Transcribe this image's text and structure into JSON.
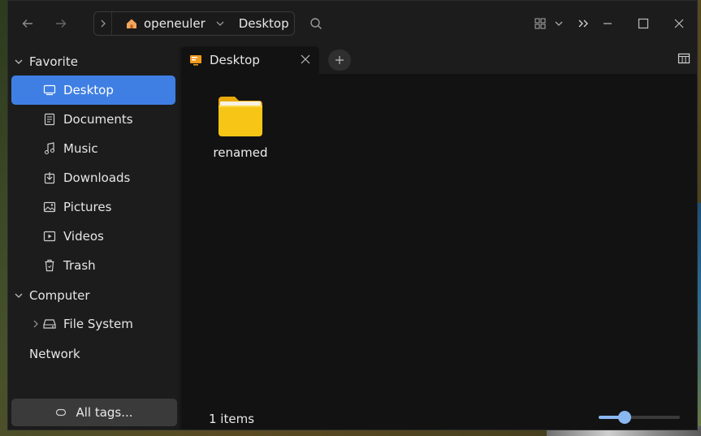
{
  "window": {
    "breadcrumb": {
      "home": "openeuler",
      "current": "Desktop"
    }
  },
  "sidebar": {
    "groups": {
      "favorite": "Favorite",
      "computer": "Computer",
      "network": "Network"
    },
    "favorite_items": [
      {
        "label": "Desktop",
        "icon": "desktop-icon",
        "active": true
      },
      {
        "label": "Documents",
        "icon": "documents-icon"
      },
      {
        "label": "Music",
        "icon": "music-icon"
      },
      {
        "label": "Downloads",
        "icon": "downloads-icon"
      },
      {
        "label": "Pictures",
        "icon": "pictures-icon"
      },
      {
        "label": "Videos",
        "icon": "videos-icon"
      },
      {
        "label": "Trash",
        "icon": "trash-icon"
      }
    ],
    "computer_items": [
      {
        "label": "File System",
        "icon": "drive-icon"
      }
    ],
    "tags_button": "All tags..."
  },
  "tabs": [
    {
      "label": "Desktop",
      "icon": "desktop-folder-icon"
    }
  ],
  "files": [
    {
      "name": "renamed",
      "type": "folder"
    }
  ],
  "status": {
    "count_text": "1 items"
  },
  "zoom": {
    "level": 0.28
  },
  "colors": {
    "accent": "#3f7fe3",
    "folder": "#f6c516",
    "slider": "#8bb7f0"
  }
}
